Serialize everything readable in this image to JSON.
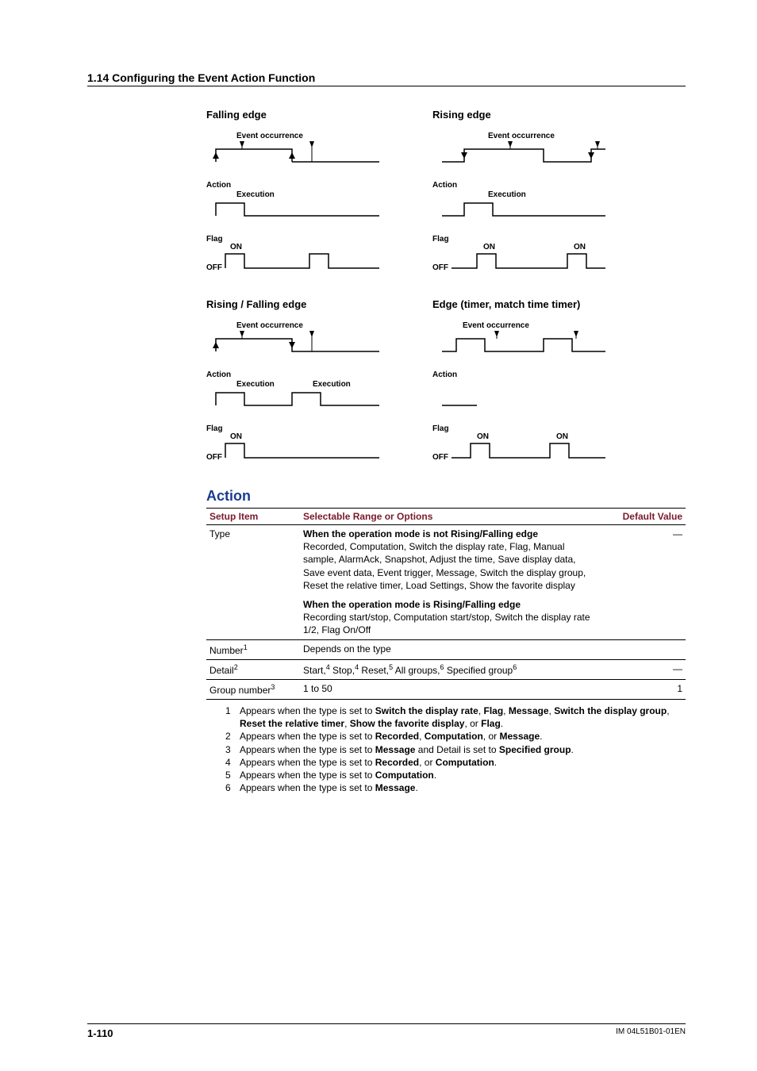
{
  "header": "1.14  Configuring the Event Action Function",
  "diagrams": {
    "falling": {
      "title": "Falling edge",
      "event": "Event occurrence",
      "action": "Action",
      "exec": "Execution",
      "flag": "Flag",
      "on": "ON",
      "off": "OFF"
    },
    "rising": {
      "title": "Rising edge",
      "event": "Event occurrence",
      "action": "Action",
      "exec": "Execution",
      "flag": "Flag",
      "on": "ON",
      "on2": "ON",
      "off": "OFF"
    },
    "both": {
      "title": "Rising / Falling edge",
      "event": "Event occurrence",
      "action": "Action",
      "exec": "Execution",
      "exec2": "Execution",
      "flag": "Flag",
      "on": "ON",
      "off": "OFF"
    },
    "edge": {
      "title": "Edge (timer, match time timer)",
      "event": "Event occurrence",
      "action": "Action",
      "flag": "Flag",
      "on": "ON",
      "on2": "ON",
      "off": "OFF"
    }
  },
  "action": {
    "heading": "Action",
    "headers": {
      "item": "Setup Item",
      "range": "Selectable Range or Options",
      "default": "Default Value"
    },
    "rows": {
      "type": {
        "label": "Type",
        "sub1": "When the operation mode is not Rising/Falling edge",
        "txt1": "Recorded, Computation, Switch the display rate, Flag, Manual sample, AlarmAck, Snapshot, Adjust the time, Save display data, Save event data, Event trigger, Message, Switch the display group, Reset the relative timer, Load Settings, Show the favorite display",
        "sub2": "When the operation mode is Rising/Falling edge",
        "txt2": "Recording start/stop, Computation start/stop, Switch the display rate 1/2, Flag On/Off",
        "def": "—"
      },
      "number": {
        "label": "Number",
        "sup": "1",
        "range": "Depends on the type",
        "def": ""
      },
      "detail": {
        "label": "Detail",
        "sup": "2",
        "parts": [
          "Start,",
          "4",
          " Stop,",
          "4",
          " Reset,",
          "5",
          " All groups,",
          "6",
          " Specified group",
          "6"
        ],
        "def": "—"
      },
      "group": {
        "label": "Group number",
        "sup": "3",
        "range": "1 to 50",
        "def": "1"
      }
    },
    "notes": [
      {
        "n": "1",
        "pre": "Appears when the type is set to ",
        "bold": [
          "Switch the display rate",
          "Flag",
          "Message",
          "Switch the display group",
          "Reset the relative timer",
          "Show the favorite display",
          "Flag"
        ]
      },
      {
        "n": "2",
        "pre": "Appears when the type is set to ",
        "bold": [
          "Recorded",
          "Computation",
          "Message"
        ]
      },
      {
        "n": "3",
        "pre": "Appears when the type is set to ",
        "bold": [
          "Message"
        ],
        "post": " and Detail is set to ",
        "bold2": [
          "Specified group"
        ]
      },
      {
        "n": "4",
        "pre": "Appears when the type is set to ",
        "bold": [
          "Recorded",
          "Computation"
        ]
      },
      {
        "n": "5",
        "pre": "Appears when the type is set to ",
        "bold": [
          "Computation"
        ]
      },
      {
        "n": "6",
        "pre": "Appears when the type is set to ",
        "bold": [
          "Message"
        ]
      }
    ]
  },
  "footer": {
    "page": "1-110",
    "doc": "IM 04L51B01-01EN"
  }
}
